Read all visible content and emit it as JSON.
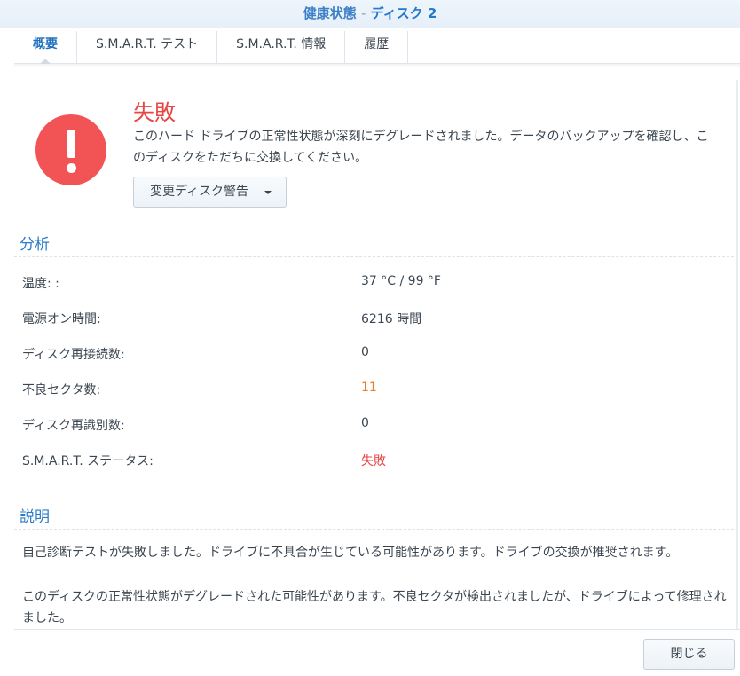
{
  "window": {
    "title_prefix": "健康状態",
    "separator": "-",
    "title_disk": "ディスク 2"
  },
  "tabs": [
    {
      "label": "概要",
      "active": true
    },
    {
      "label": "S.M.A.R.T. テスト"
    },
    {
      "label": "S.M.A.R.T. 情報"
    },
    {
      "label": "履歴"
    }
  ],
  "status": {
    "title": "失敗",
    "description": "このハード ドライブの正常性状態が深刻にデグレードされました。データのバックアップを確認し、このディスクをただちに交換してください。",
    "warning_button": "変更ディスク警告"
  },
  "analysis": {
    "title": "分析",
    "rows": [
      {
        "label": "温度: :",
        "value": "37 °C / 99 °F"
      },
      {
        "label": "電源オン時間:",
        "value": "6216 時間"
      },
      {
        "label": "ディスク再接続数:",
        "value": "0"
      },
      {
        "label": "不良セクタ数:",
        "value": "11"
      },
      {
        "label": "ディスク再識別数:",
        "value": "0"
      },
      {
        "label": "S.M.A.R.T. ステータス:",
        "value": "失敗"
      }
    ]
  },
  "explanation": {
    "title": "説明",
    "para1": "自己診断テストが失敗しました。ドライブに不具合が生じている可能性があります。ドライブの交換が推奨されます。",
    "para2": "このディスクの正常性状態がデグレードされた可能性があります。不良セクタが検出されましたが、ドライブによって修理されました。"
  },
  "footer": {
    "close_button": "閉じる"
  },
  "colors": {
    "accent": "#2c7bc9",
    "error": "#e84545",
    "warning": "#ee7a1f"
  }
}
